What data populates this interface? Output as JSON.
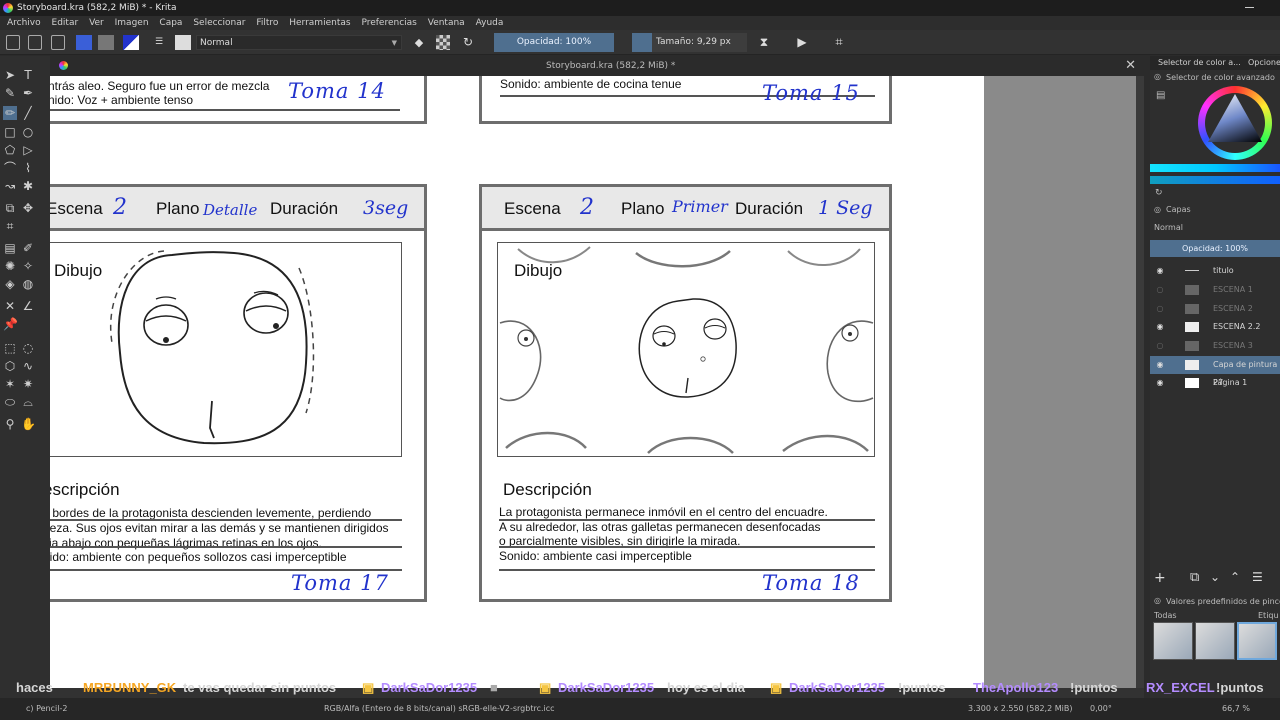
{
  "window": {
    "title": "Storyboard.kra (582,2 MiB) * - Krita"
  },
  "menu": [
    "Archivo",
    "Editar",
    "Ver",
    "Imagen",
    "Capa",
    "Seleccionar",
    "Filtro",
    "Herramientas",
    "Preferencias",
    "Ventana",
    "Ayuda"
  ],
  "toolbar": {
    "blend_mode": "Normal",
    "opacity": "Opacidad: 100%",
    "size": "Tamaño: 9,29 px"
  },
  "document_tab": {
    "label": "Storyboard.kra (582,2 MiB) *"
  },
  "storyboard": {
    "top_left": {
      "desc_tail": "ntrás aleo. Seguro fue un error de mezcla",
      "sound": "nido: Voz + ambiente tenso",
      "toma": "Toma 14"
    },
    "top_right": {
      "sound": "Sonido: ambiente de cocina tenue",
      "toma": "Toma 15"
    },
    "panel17": {
      "escena_label": "Escena",
      "escena_val": "2",
      "plano_label": "Plano",
      "plano_val": "Detalle",
      "duracion_label": "Duración",
      "duracion_val": "3seg",
      "dibujo": "Dibujo",
      "desc_title": "escripción",
      "lines": [
        "s bordes de la protagonista descienden levemente, perdiendo",
        "neza. Sus ojos evitan mirar a las demás y se mantienen dirigidos",
        "cia abajo con pequeñas lágrimas retinas en los ojos.",
        "nido: ambiente con pequeños sollozos casi imperceptible"
      ],
      "toma": "Toma 17"
    },
    "panel18": {
      "escena_label": "Escena",
      "escena_val": "2",
      "plano_label": "Plano",
      "plano_val": "Primer",
      "duracion_label": "Duración",
      "duracion_val": "1 Seg",
      "dibujo": "Dibujo",
      "desc_title": "Descripción",
      "lines": [
        "La protagonista permanece inmóvil en el centro del encuadre.",
        "A su alrededor, las otras galletas permanecen desenfocadas",
        " o parcialmente visibles, sin dirigirle la mirada.",
        "Sonido: ambiente casi imperceptible"
      ],
      "toma": "Toma 18"
    }
  },
  "right_panel": {
    "tab1": "Selector de color a...",
    "tab2": "Opcione",
    "color_title": "Selector de color avanzado",
    "layers_title": "Capas",
    "blend": "Normal",
    "opacity": "Opacidad:  100%",
    "layers": [
      {
        "name": "titulo",
        "visible": true,
        "dim": false,
        "selected": false
      },
      {
        "name": "ESCENA 1",
        "visible": false,
        "dim": true,
        "selected": false
      },
      {
        "name": "ESCENA 2",
        "visible": false,
        "dim": true,
        "selected": false
      },
      {
        "name": "ESCENA 2.2",
        "visible": true,
        "dim": false,
        "selected": false
      },
      {
        "name": "ESCENA 3",
        "visible": false,
        "dim": true,
        "selected": false
      },
      {
        "name": "Capa de pintura 27",
        "visible": true,
        "dim": false,
        "selected": true
      },
      {
        "name": "Página 1",
        "visible": true,
        "dim": false,
        "selected": false
      }
    ],
    "presets_title": "Valores predefinidos de pincel",
    "presets_filter": "Todas",
    "presets_tag": "Etiqu"
  },
  "chat_ticker": [
    {
      "text": "haces",
      "color": "#ffffff"
    },
    {
      "text": "MRBUNNY_GK",
      "color": "#f5a623"
    },
    {
      "text": "te vas quedar sin puntos",
      "color": "#ffffff"
    },
    {
      "text": "DarkSaDor1235",
      "color": "#b48cff"
    },
    {
      "text": "DarkSaDor1235",
      "color": "#b48cff"
    },
    {
      "text": "hoy es el dia",
      "color": "#ffffff"
    },
    {
      "text": "DarkSaDor1235",
      "color": "#b48cff"
    },
    {
      "text": "!puntos",
      "color": "#ffffff"
    },
    {
      "text": "TheApollo123",
      "color": "#b48cff"
    },
    {
      "text": "!puntos",
      "color": "#ffffff"
    },
    {
      "text": "RX_EXCEL",
      "color": "#b48cff"
    },
    {
      "text": "!puntos",
      "color": "#ffffff"
    }
  ],
  "status": {
    "brush": "c) Pencil-2",
    "colorspace": "RGB/Alfa (Entero de 8 bits/canal)  sRGB-elle-V2-srgbtrc.icc",
    "dims": "3.300 x 2.550 (582,2 MiB)",
    "rotation": "0,00°",
    "zoom": "66,7 %"
  }
}
